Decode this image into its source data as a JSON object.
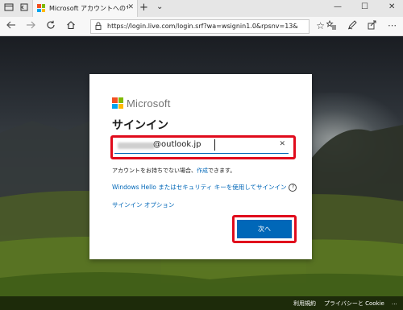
{
  "browser": {
    "tab_title": "Microsoft アカウントへのサ",
    "address_url": "https://login.live.com/login.srf?wa=wsignin1.0&rpsnv=13&",
    "tab_close_glyph": "✕",
    "new_tab_glyph": "+",
    "tab_menu_glyph": "⌄",
    "window_buttons": [
      "—",
      "☐",
      "✕"
    ]
  },
  "dialog": {
    "brand": "Microsoft",
    "title": "サインイン",
    "email_domain": "@outlook.jp",
    "clear_glyph": "✕",
    "no_account_prefix": "アカウントをお持ちでない場合、",
    "no_account_link": "作成",
    "no_account_suffix": "できます。",
    "windows_hello": "Windows Hello またはセキュリティ キーを使用してサインイン",
    "help_glyph": "?",
    "signin_options": "サインイン オプション",
    "next_button": "次へ"
  },
  "footer": {
    "terms": "利用規約",
    "privacy": "プライバシーと Cookie",
    "more": "..."
  },
  "colors": {
    "accent": "#0067b8",
    "highlight": "#e00b1c",
    "ms_red": "#f25022",
    "ms_green": "#7fba00",
    "ms_blue": "#00a4ef",
    "ms_yellow": "#ffb900"
  }
}
